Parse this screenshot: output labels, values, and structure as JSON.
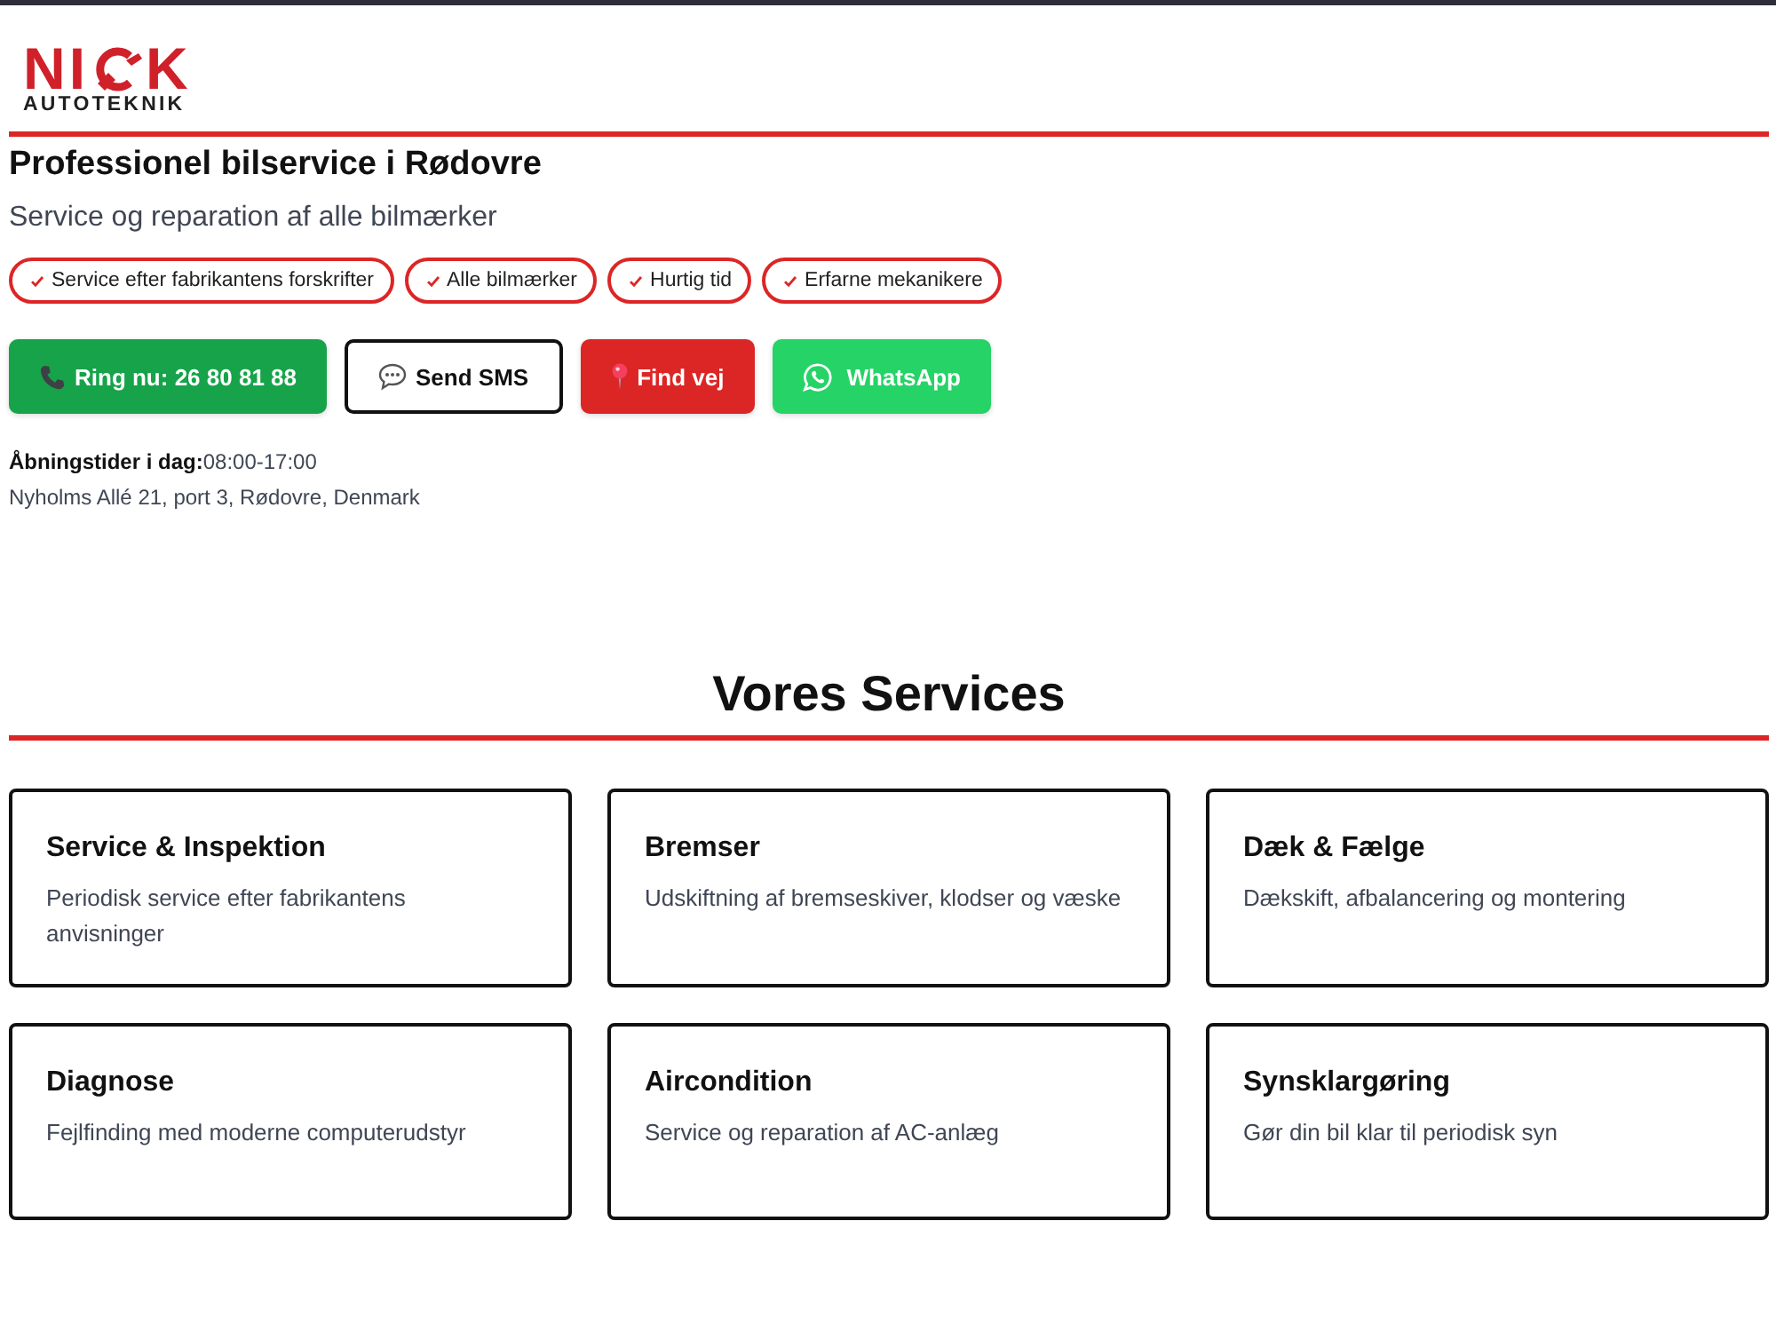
{
  "logo": {
    "mark_left": "NI",
    "mark_right": "K",
    "tagline": "AUTOTEKNIK"
  },
  "hero": {
    "title": "Professionel bilservice i Rødovre",
    "subtitle": "Service og reparation af alle bilmærker"
  },
  "badges": [
    "Service efter fabrikantens forskrifter",
    "Alle bilmærker",
    "Hurtig tid",
    "Erfarne mekanikere"
  ],
  "actions": [
    {
      "kind": "call",
      "label": "Ring nu: 26 80 81 88"
    },
    {
      "kind": "sms",
      "label": "Send SMS"
    },
    {
      "kind": "directions",
      "label": "Find vej"
    },
    {
      "kind": "whatsapp",
      "label": "WhatsApp"
    }
  ],
  "info": {
    "hours_label": "Åbningstider i dag:",
    "hours_value": "08:00-17:00",
    "address": "Nyholms Allé 21, port 3, Rødovre, Denmark"
  },
  "services": {
    "title": "Vores Services",
    "cards": [
      {
        "title": "Service & Inspektion",
        "description": "Periodisk service efter fabrikantens anvisninger"
      },
      {
        "title": "Bremser",
        "description": "Udskiftning af bremseskiver, klodser og væske"
      },
      {
        "title": "Dæk & Fælge",
        "description": "Dækskift, afbalancering og montering"
      },
      {
        "title": "Diagnose",
        "description": "Fejlfinding med moderne computerudstyr"
      },
      {
        "title": "Aircondition",
        "description": "Service og reparation af AC-anlæg"
      },
      {
        "title": "Synsklargøring",
        "description": "Gør din bil klar til periodisk syn"
      }
    ]
  }
}
